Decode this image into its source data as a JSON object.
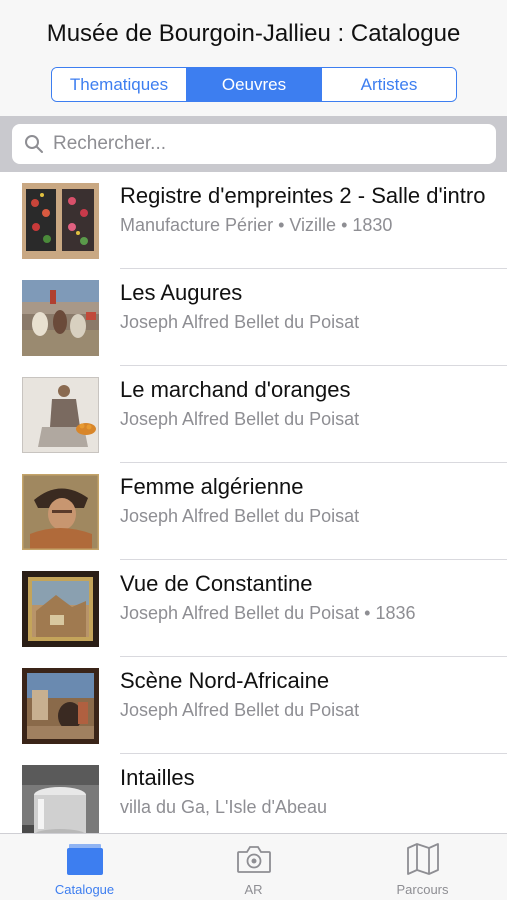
{
  "header": {
    "title": "Musée de Bourgoin-Jallieu : Catalogue",
    "segments": [
      {
        "label": "Thematiques",
        "active": false
      },
      {
        "label": "Oeuvres",
        "active": true
      },
      {
        "label": "Artistes",
        "active": false
      }
    ]
  },
  "search": {
    "placeholder": "Rechercher...",
    "value": ""
  },
  "items": [
    {
      "title": "Registre d'empreintes 2 - Salle d'intro",
      "subtitle": "Manufacture Périer • Vizille • 1830"
    },
    {
      "title": "Les Augures",
      "subtitle": "Joseph Alfred Bellet du Poisat"
    },
    {
      "title": "Le marchand d'oranges",
      "subtitle": "Joseph Alfred Bellet du Poisat"
    },
    {
      "title": "Femme algérienne",
      "subtitle": "Joseph Alfred Bellet du Poisat"
    },
    {
      "title": "Vue de Constantine",
      "subtitle": "Joseph Alfred Bellet du Poisat • 1836"
    },
    {
      "title": "Scène Nord-Africaine",
      "subtitle": "Joseph Alfred Bellet du Poisat"
    },
    {
      "title": "Intailles",
      "subtitle": "villa du Ga, L'Isle d'Abeau"
    }
  ],
  "tabbar": {
    "tabs": [
      {
        "label": "Catalogue",
        "icon": "catalogue-icon",
        "active": true
      },
      {
        "label": "AR",
        "icon": "camera-icon",
        "active": false
      },
      {
        "label": "Parcours",
        "icon": "map-icon",
        "active": false
      }
    ]
  },
  "colors": {
    "accent": "#3d7ef0",
    "secondary_text": "#8e8e93"
  }
}
